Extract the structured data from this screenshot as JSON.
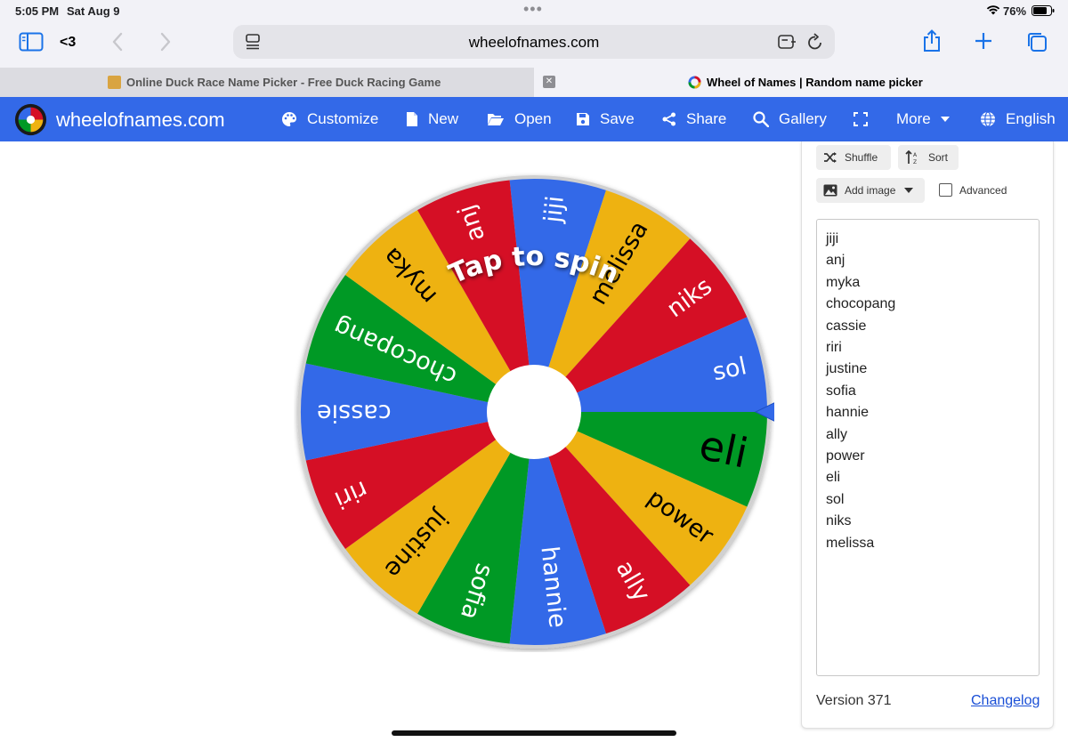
{
  "status_bar": {
    "time": "5:05 PM",
    "date": "Sat Aug 9",
    "battery": "76%"
  },
  "browser": {
    "back_label": "<3",
    "url": "wheelofnames.com",
    "tabs": [
      {
        "title": "Online Duck Race Name Picker - Free Duck Racing Game",
        "active": false
      },
      {
        "title": "Wheel of Names | Random name picker",
        "active": true
      }
    ]
  },
  "app": {
    "brand": "wheelofnames.com",
    "nav": [
      "Customize",
      "New",
      "Open",
      "Save",
      "Share",
      "Gallery",
      "More",
      "English"
    ]
  },
  "wheel": {
    "center_text": "Tap to spin",
    "segments": [
      {
        "label": "jiji",
        "color": "#3369e8"
      },
      {
        "label": "melissa",
        "color": "#eeb211"
      },
      {
        "label": "niks",
        "color": "#d50f25"
      },
      {
        "label": "sol",
        "color": "#3369e8"
      },
      {
        "label": "eli",
        "color": "#009925"
      },
      {
        "label": "power",
        "color": "#eeb211"
      },
      {
        "label": "ally",
        "color": "#d50f25"
      },
      {
        "label": "hannie",
        "color": "#3369e8"
      },
      {
        "label": "sofia",
        "color": "#009925"
      },
      {
        "label": "justine",
        "color": "#eeb211"
      },
      {
        "label": "riri",
        "color": "#d50f25"
      },
      {
        "label": "cassie",
        "color": "#3369e8"
      },
      {
        "label": "chocopang",
        "color": "#009925"
      },
      {
        "label": "myka",
        "color": "#eeb211"
      },
      {
        "label": "anj",
        "color": "#d50f25"
      }
    ]
  },
  "panel": {
    "shuffle_label": "Shuffle",
    "sort_label": "Sort",
    "add_image_label": "Add image",
    "advanced_label": "Advanced",
    "entries": [
      "jiji",
      "anj",
      "myka",
      "chocopang",
      "cassie",
      "riri",
      "justine",
      "sofia",
      "hannie",
      "ally",
      "power",
      "eli",
      "sol",
      "niks",
      "melissa"
    ],
    "version": "Version 371",
    "changelog": "Changelog"
  }
}
